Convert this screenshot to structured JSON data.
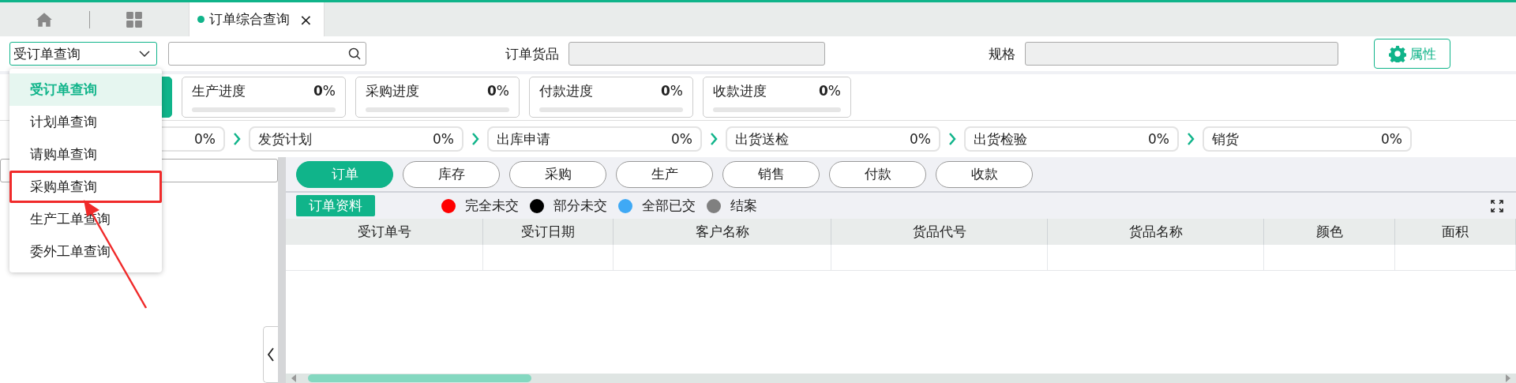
{
  "tab_bar": {
    "tabs": [
      {
        "label": "订单综合查询",
        "close": "×",
        "selected": true
      }
    ]
  },
  "toolbar": {
    "query_type": "受订单查询",
    "fields": [
      {
        "label": "订单货品"
      },
      {
        "label": "规格"
      }
    ],
    "button": "属性"
  },
  "progress_cards": [
    {
      "selected": true
    },
    {
      "label": "生产进度",
      "value": "**0**%",
      "level": 0,
      "selected": false
    },
    {
      "label": "采购进度",
      "value": "**0**%",
      "level": 0,
      "selected": false
    },
    {
      "label": "付款进度",
      "value": "**0**%",
      "level": 0,
      "selected": false
    },
    {
      "label": "收款进度",
      "value": "**0**%",
      "level": 0,
      "selected": false
    }
  ],
  "steps": [
    {
      "percent": "0%"
    },
    {
      "label": "发货计划",
      "percent": "0%"
    },
    {
      "label": "出库申请",
      "percent": "0%"
    },
    {
      "label": "出货送检",
      "percent": "0%"
    },
    {
      "label": "出货检验",
      "percent": "0%"
    },
    {
      "label": "销货",
      "percent": "0%"
    }
  ],
  "category_buttons": [
    {
      "label": "订单",
      "selected": true
    },
    {
      "label": "库存",
      "selected": false
    },
    {
      "label": "采购",
      "selected": false
    },
    {
      "label": "生产",
      "selected": false
    },
    {
      "label": "销售",
      "selected": false
    },
    {
      "label": "付款",
      "selected": false
    },
    {
      "label": "收款",
      "selected": false
    }
  ],
  "section_label": "订单资料",
  "legend": [
    {
      "label": "完全未交",
      "color": "#ff0000"
    },
    {
      "label": "部分未交",
      "color": "#000000"
    },
    {
      "label": "全部已交",
      "color": "#3fa9f5"
    },
    {
      "label": "结案",
      "color": "#808080"
    }
  ],
  "table": {
    "columns": [
      "受订单号",
      "受订日期",
      "客户名称",
      "货品代号",
      "货品名称",
      "颜色",
      "面积"
    ]
  },
  "dropdown": {
    "items": [
      {
        "label": "受订单查询",
        "selected": true,
        "highlighted": false
      },
      {
        "label": "计划单查询",
        "selected": false,
        "highlighted": false
      },
      {
        "label": "请购单查询",
        "selected": false,
        "highlighted": false
      },
      {
        "label": "采购单查询",
        "selected": false,
        "highlighted": true
      },
      {
        "label": "生产工单查询",
        "selected": false,
        "highlighted": false
      },
      {
        "label": "委外工单查询",
        "selected": false,
        "highlighted": false
      }
    ]
  }
}
